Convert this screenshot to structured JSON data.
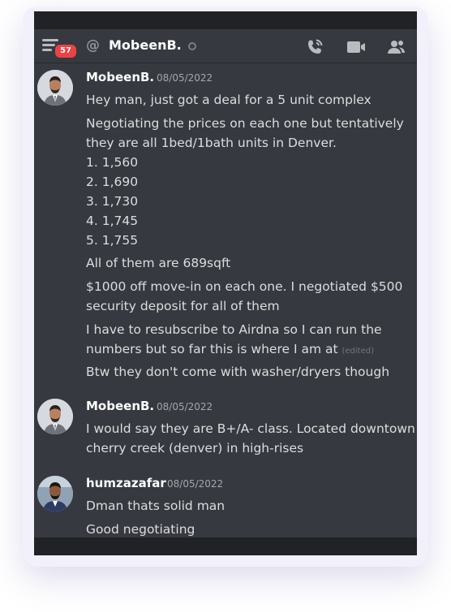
{
  "header": {
    "unread_badge": "57",
    "at_symbol": "@",
    "title": "MobeenB.",
    "icons": [
      "menu-icon",
      "call-icon",
      "video-icon",
      "members-icon"
    ]
  },
  "messages": [
    {
      "author": "MobeenB.",
      "timestamp": "08/05/2022",
      "lines": [
        "Hey man, just got a deal for a 5 unit complex",
        "Negotiating the prices on each one but tentatively",
        "they are all 1bed/1bath units in Denver.",
        "1. 1,560",
        "2. 1,690",
        "3. 1,730",
        "4. 1,745",
        "5. 1,755",
        "All of them are 689sqft",
        "$1000 off move-in on each one. I negotiated $500",
        "security deposit for all of them",
        "I have to resubscribe to Airdna so I can run the",
        "numbers but so far this is where I am at",
        "Btw they don't come with washer/dryers though"
      ],
      "edited_label": "(edited)"
    },
    {
      "author": "MobeenB.",
      "timestamp": "08/05/2022",
      "lines": [
        "I would say they are B+/A- class. Located downtown",
        "cherry creek (denver) in high-rises"
      ]
    },
    {
      "author": "humzazafar",
      "timestamp": "08/05/2022",
      "lines": [
        "Dman thats solid man",
        "Good negotiating"
      ]
    }
  ],
  "colors": {
    "background": "#36393f",
    "badge": "#ed4245",
    "text": "#dcddde",
    "timestamp": "#a3a6aa"
  }
}
